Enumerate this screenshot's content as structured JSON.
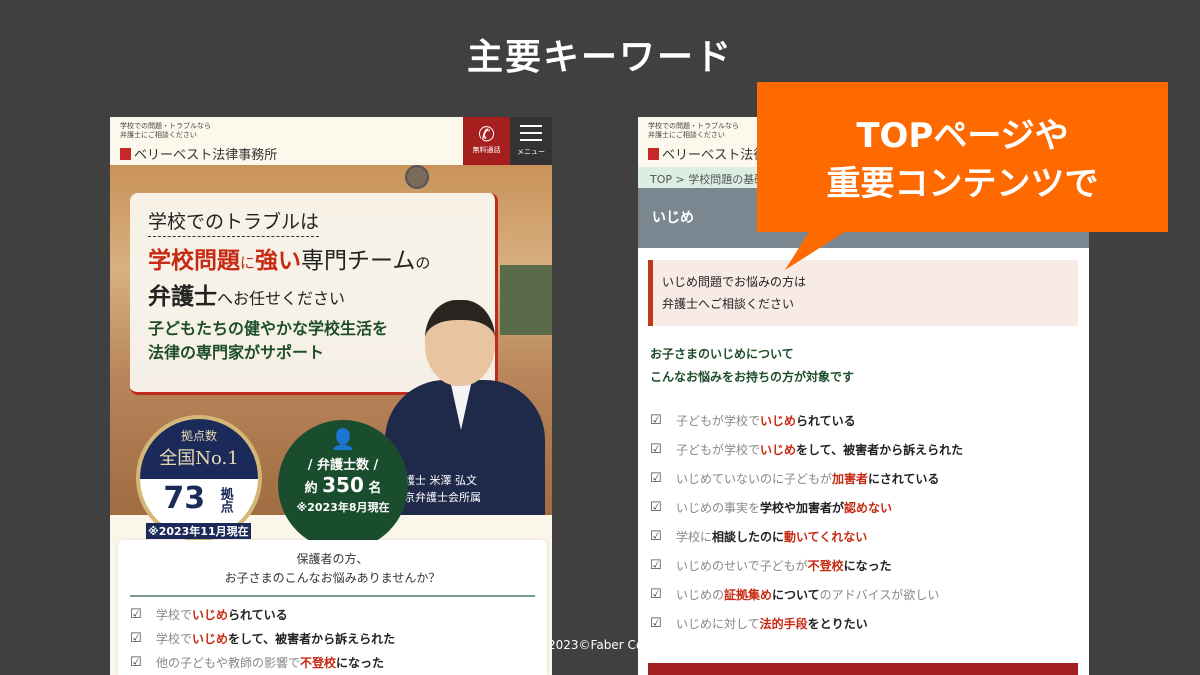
{
  "slide": {
    "title": "主要キーワード",
    "copyright": "2023©Faber Co"
  },
  "callout": {
    "line1": "TOPページや",
    "line2": "重要コンテンツで",
    "color": "#ff6a00"
  },
  "site": {
    "tagline1": "学校での問題・トラブルなら",
    "tagline2": "弁護士にご相談ください",
    "logo": "ベリーベスト法律事務所",
    "call_label": "無料通話",
    "menu_label": "メニュー"
  },
  "left": {
    "hero": {
      "line1": "学校でのトラブルは",
      "line2_red1": "学校問題",
      "line2_a": "に",
      "line2_red2": "強い",
      "line2_b": "専門チーム",
      "line2_c": "の",
      "line3_a": "弁護士",
      "line3_b": "へお任せください",
      "sub1": "子どもたちの健やかな学校生活を",
      "sub2": "法律の専門家がサポート"
    },
    "badge1": {
      "label": "拠点数",
      "rank": "全国No.1",
      "number": "73",
      "unit": "拠点",
      "date": "※2023年11月現在"
    },
    "badge2": {
      "label": "/ 弁護士数 /",
      "prefix": "約",
      "number": "350",
      "unit": "名",
      "date": "※2023年8月現在"
    },
    "lawyer": {
      "name": "弁護士 米澤 弘文",
      "affiliation": "東京弁護士会所属"
    },
    "question": {
      "line1": "保護者の方、",
      "line2": "お子さまのこんなお悩みありませんか？"
    },
    "items": [
      [
        {
          "t": "学校で",
          "s": "g"
        },
        {
          "t": "いじめ",
          "s": "r"
        },
        {
          "t": "られている",
          "s": "k"
        }
      ],
      [
        {
          "t": "学校で",
          "s": "g"
        },
        {
          "t": "いじめ",
          "s": "r"
        },
        {
          "t": "をして、被害者から訴えられた",
          "s": "k"
        }
      ],
      [
        {
          "t": "他の子どもや教師の影響で",
          "s": "g"
        },
        {
          "t": "不登校",
          "s": "r"
        },
        {
          "t": "になった",
          "s": "k"
        }
      ]
    ]
  },
  "right": {
    "breadcrumb": {
      "home": "TOP",
      "current": "学校問題の基礎"
    },
    "banner_title": "いじめ",
    "notice": {
      "line1": "いじめ問題でお悩みの方は",
      "line2": "弁護士へご相談ください"
    },
    "heading": {
      "line1": "お子さまのいじめについて",
      "line2": "こんなお悩みをお持ちの方が対象です"
    },
    "items": [
      [
        {
          "t": "子どもが学校で",
          "s": "g"
        },
        {
          "t": "いじめ",
          "s": "r"
        },
        {
          "t": "られている",
          "s": "k"
        }
      ],
      [
        {
          "t": "子どもが学校で",
          "s": "g"
        },
        {
          "t": "いじめ",
          "s": "r"
        },
        {
          "t": "をして、被害者から訴えられた",
          "s": "k"
        }
      ],
      [
        {
          "t": "いじめていないのに子どもが",
          "s": "g"
        },
        {
          "t": "加害者",
          "s": "r"
        },
        {
          "t": "にされている",
          "s": "k"
        }
      ],
      [
        {
          "t": "いじめの事実を",
          "s": "g"
        },
        {
          "t": "学校や加害者が",
          "s": "k"
        },
        {
          "t": "認めない",
          "s": "r"
        }
      ],
      [
        {
          "t": "学校に",
          "s": "g"
        },
        {
          "t": "相談したのに",
          "s": "k"
        },
        {
          "t": "動いてくれない",
          "s": "r"
        }
      ],
      [
        {
          "t": "いじめのせいで子どもが",
          "s": "g"
        },
        {
          "t": "不登校",
          "s": "r"
        },
        {
          "t": "になった",
          "s": "k"
        }
      ],
      [
        {
          "t": "いじめの",
          "s": "g"
        },
        {
          "t": "証拠集め",
          "s": "r"
        },
        {
          "t": "について",
          "s": "k"
        },
        {
          "t": "のアドバイスが欲しい",
          "s": "g"
        }
      ],
      [
        {
          "t": "いじめに対して",
          "s": "g"
        },
        {
          "t": "法的手段",
          "s": "r"
        },
        {
          "t": "をとりたい",
          "s": "k"
        }
      ]
    ]
  }
}
